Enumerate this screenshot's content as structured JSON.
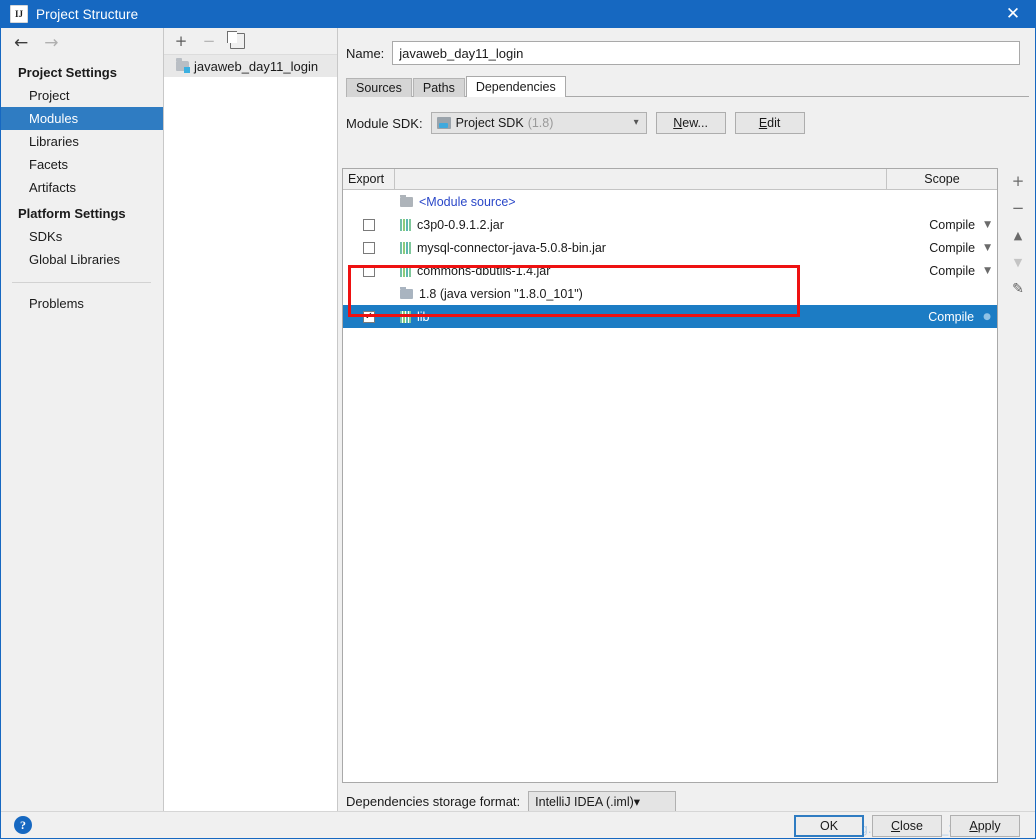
{
  "window": {
    "title": "Project Structure",
    "app_icon": "intellij-idea-icon",
    "close_label": "✕"
  },
  "sidebar": {
    "nav": {
      "back": "←",
      "forward": "→"
    },
    "groups": [
      {
        "title": "Project Settings",
        "items": [
          {
            "label": "Project",
            "selected": false
          },
          {
            "label": "Modules",
            "selected": true
          },
          {
            "label": "Libraries",
            "selected": false
          },
          {
            "label": "Facets",
            "selected": false
          },
          {
            "label": "Artifacts",
            "selected": false
          }
        ]
      },
      {
        "title": "Platform Settings",
        "items": [
          {
            "label": "SDKs",
            "selected": false
          },
          {
            "label": "Global Libraries",
            "selected": false
          }
        ]
      }
    ],
    "problems": {
      "label": "Problems"
    }
  },
  "module_panel": {
    "toolbar": {
      "add": "+",
      "remove": "−",
      "copy_icon": "copy-icon"
    },
    "items": [
      {
        "label": "javaweb_day11_login",
        "selected": true
      }
    ]
  },
  "content": {
    "name_label": "Name:",
    "name_value": "javaweb_day11_login",
    "tabs": [
      {
        "label": "Sources",
        "active": false
      },
      {
        "label": "Paths",
        "active": false
      },
      {
        "label": "Dependencies",
        "active": true
      }
    ],
    "sdk_label": "Module SDK:",
    "sdk_value": "Project SDK",
    "sdk_version": "(1.8)",
    "new_button": "New...",
    "edit_button": "Edit",
    "table": {
      "columns": {
        "export": "Export",
        "scope": "Scope"
      },
      "rows": [
        {
          "name": "<Module source>",
          "icon": "module-source-icon",
          "checkbox": null,
          "scope": "",
          "style": "module-source"
        },
        {
          "name": "c3p0-0.9.1.2.jar",
          "icon": "jar-icon",
          "checkbox": false,
          "scope": "Compile",
          "style": "jar"
        },
        {
          "name": "mysql-connector-java-5.0.8-bin.jar",
          "icon": "jar-icon",
          "checkbox": false,
          "scope": "Compile",
          "style": "jar"
        },
        {
          "name": "commons-dbutils-1.4.jar",
          "icon": "jar-icon",
          "checkbox": false,
          "scope": "Compile",
          "style": "jar"
        },
        {
          "name": "1.8 (java version \"1.8.0_101\")",
          "icon": "jdk-icon",
          "checkbox": null,
          "scope": "",
          "style": "jdk"
        },
        {
          "name": "lib",
          "icon": "jar-icon",
          "checkbox": true,
          "scope": "Compile",
          "style": "jar",
          "selected": true
        }
      ]
    },
    "side_toolbar": {
      "add": "+",
      "remove": "−",
      "move_up": "▲",
      "move_down": "▼",
      "edit": "✎"
    },
    "storage_label": "Dependencies storage format:",
    "storage_value": "IntelliJ IDEA (.iml)"
  },
  "footer": {
    "help_icon": "?",
    "ok": "OK",
    "close": "Close",
    "apply": "Apply",
    "watermark": "https://blog.csdn.net/qq_38050100"
  },
  "annotation": {
    "type": "red-rectangle-highlight",
    "target": "lib",
    "color": "#ee1111"
  }
}
